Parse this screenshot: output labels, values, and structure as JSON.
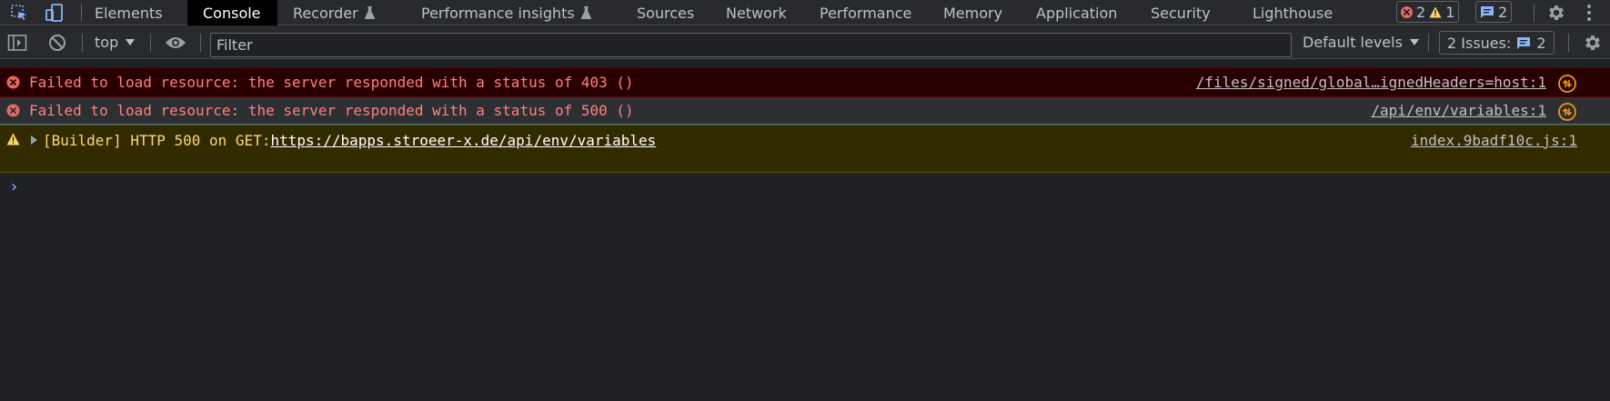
{
  "tabs": [
    {
      "label": "Elements"
    },
    {
      "label": "Console"
    },
    {
      "label": "Recorder"
    },
    {
      "label": "Performance insights"
    },
    {
      "label": "Sources"
    },
    {
      "label": "Network"
    },
    {
      "label": "Performance"
    },
    {
      "label": "Memory"
    },
    {
      "label": "Application"
    },
    {
      "label": "Security"
    },
    {
      "label": "Lighthouse"
    }
  ],
  "counters": {
    "errors": "2",
    "warnings": "1",
    "messages": "2"
  },
  "toolbar": {
    "context": "top",
    "filter_placeholder": "Filter",
    "levels": "Default levels",
    "issues_label": "2 Issues:",
    "issues_count": "2"
  },
  "messages": [
    {
      "level": "error",
      "text": "Failed to load resource: the server responded with a status of 403 ()",
      "source": "/files/signed/global…ignedHeaders=host:1"
    },
    {
      "level": "error",
      "text": "Failed to load resource: the server responded with a status of 500 ()",
      "source": "/api/env/variables:1"
    },
    {
      "level": "warning",
      "prefix": "[Builder] HTTP 500 on GET:",
      "link": "https://bapps.stroeer-x.de/api/env/variables",
      "source": "index.9badf10c.js:1"
    }
  ],
  "prompt": "›",
  "colors": {
    "error_bg": "#290000",
    "error_text": "#ff8080",
    "warn_bg": "#332b00",
    "warn_text": "#fcd779",
    "accent_blue": "#8ab4f8",
    "upload_icon": "#f29900"
  },
  "icons": [
    "inspect-element-icon",
    "device-toolbar-icon",
    "flask-icon",
    "error-icon",
    "warning-icon",
    "message-icon",
    "settings-gear-icon",
    "kebab-menu-icon",
    "sidebar-toggle-icon",
    "clear-console-icon",
    "eye-icon",
    "upload-icon"
  ]
}
